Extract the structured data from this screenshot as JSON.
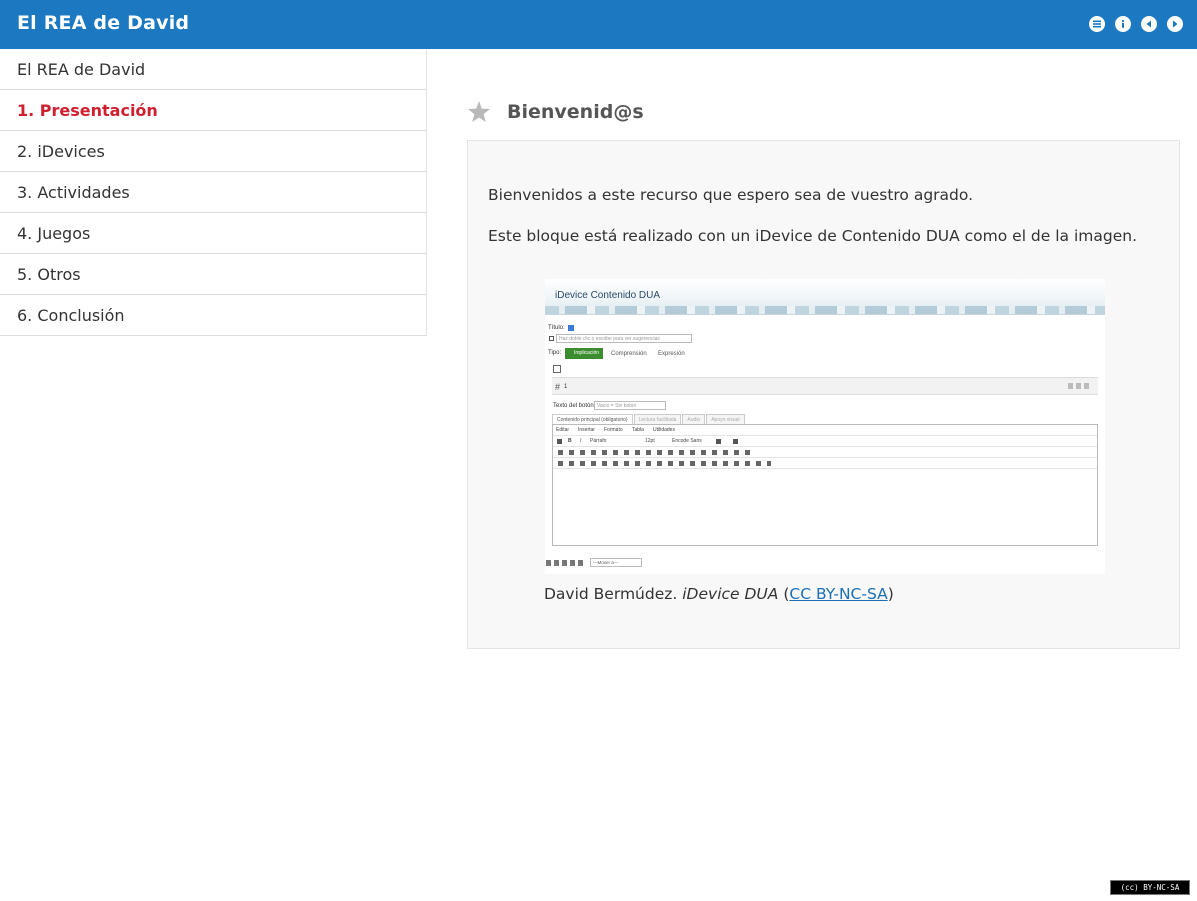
{
  "header": {
    "title": "El REA de David",
    "icons": [
      "menu-icon",
      "info-icon",
      "previous-icon",
      "next-icon"
    ]
  },
  "sidebar": {
    "items": [
      {
        "label": "El REA de David",
        "active": false
      },
      {
        "label": "1. Presentación",
        "active": true
      },
      {
        "label": "2. iDevices",
        "active": false
      },
      {
        "label": "3. Actividades",
        "active": false
      },
      {
        "label": "4. Juegos",
        "active": false
      },
      {
        "label": "5. Otros",
        "active": false
      },
      {
        "label": "6. Conclusión",
        "active": false
      }
    ]
  },
  "main": {
    "title": "Bienvenid@s",
    "title_icon": "star-icon",
    "paragraphs": [
      "Bienvenidos a este recurso que espero sea de vuestro agrado.",
      "Este bloque está realizado con un iDevice de Contenido DUA como el de la imagen."
    ],
    "figure": {
      "screenshot": {
        "banner_title": "iDevice Contenido DUA",
        "titulo_label": "Título:",
        "titulo_placeholder": "Haz doble clic o escribe para ver sugerencias",
        "tipo_label": "Tipo:",
        "tipo_options": [
          "Implicación",
          "Comprensión",
          "Expresión"
        ],
        "block_number": "1",
        "button_text_label": "Texto del botón:",
        "button_text_placeholder": "Vacío = Sin botón",
        "tabs": [
          "Contenido principal (obligatorio)",
          "Lectura facilitada",
          "Audio",
          "Apoyo visual"
        ],
        "menus": [
          "Editar",
          "Insertar",
          "Formato",
          "Tabla",
          "Utilidades"
        ],
        "format_select": "Párrafo",
        "size_select": "12pt",
        "font_select": "Encode Sans",
        "move_select": "---Mover a---"
      },
      "caption": {
        "author": "David Bermúdez.",
        "work": "iDevice DUA",
        "license": "CC BY-NC-SA"
      }
    }
  },
  "footer": {
    "license_badge": "(cc) BY-NC-SA"
  }
}
